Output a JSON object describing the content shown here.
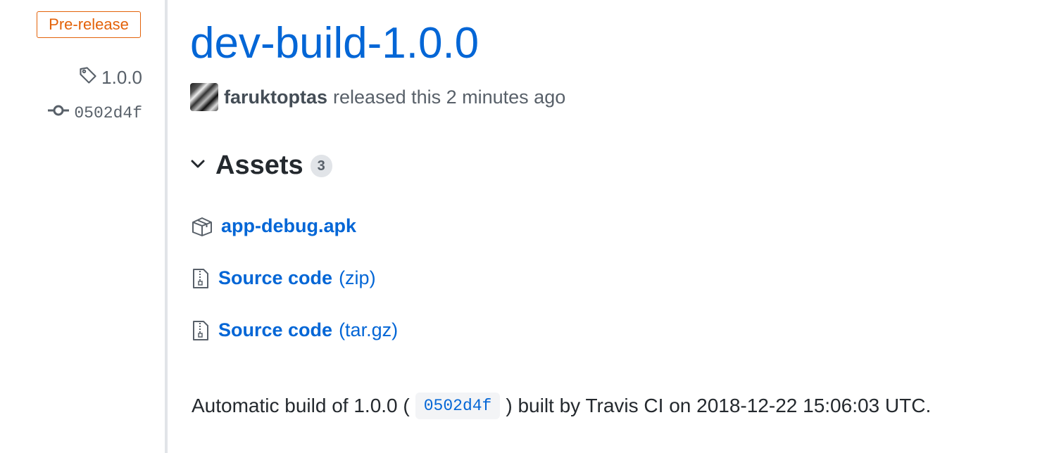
{
  "meta": {
    "badge": "Pre-release",
    "tag": "1.0.0",
    "commit": "0502d4f",
    "icons": [
      "tag-icon",
      "git-commit-icon"
    ]
  },
  "release": {
    "title": "dev-build-1.0.0",
    "author": "faruktoptas",
    "released_text": "released this 2 minutes ago"
  },
  "assets": {
    "title": "Assets",
    "count": "3",
    "items": [
      {
        "name": "app-debug.apk",
        "ext": "",
        "icon": "package-icon"
      },
      {
        "name": "Source code",
        "ext": "(zip)",
        "icon": "file-zip-icon"
      },
      {
        "name": "Source code",
        "ext": "(tar.gz)",
        "icon": "file-zip-icon"
      }
    ]
  },
  "description": {
    "before": "Automatic build of 1.0.0 (",
    "commit": "0502d4f",
    "after": ") built by Travis CI on 2018-12-22 15:06:03 UTC."
  },
  "colors": {
    "link": "#0366d6",
    "prerelease": "#e36209",
    "muted": "#586069",
    "text": "#24292e"
  }
}
